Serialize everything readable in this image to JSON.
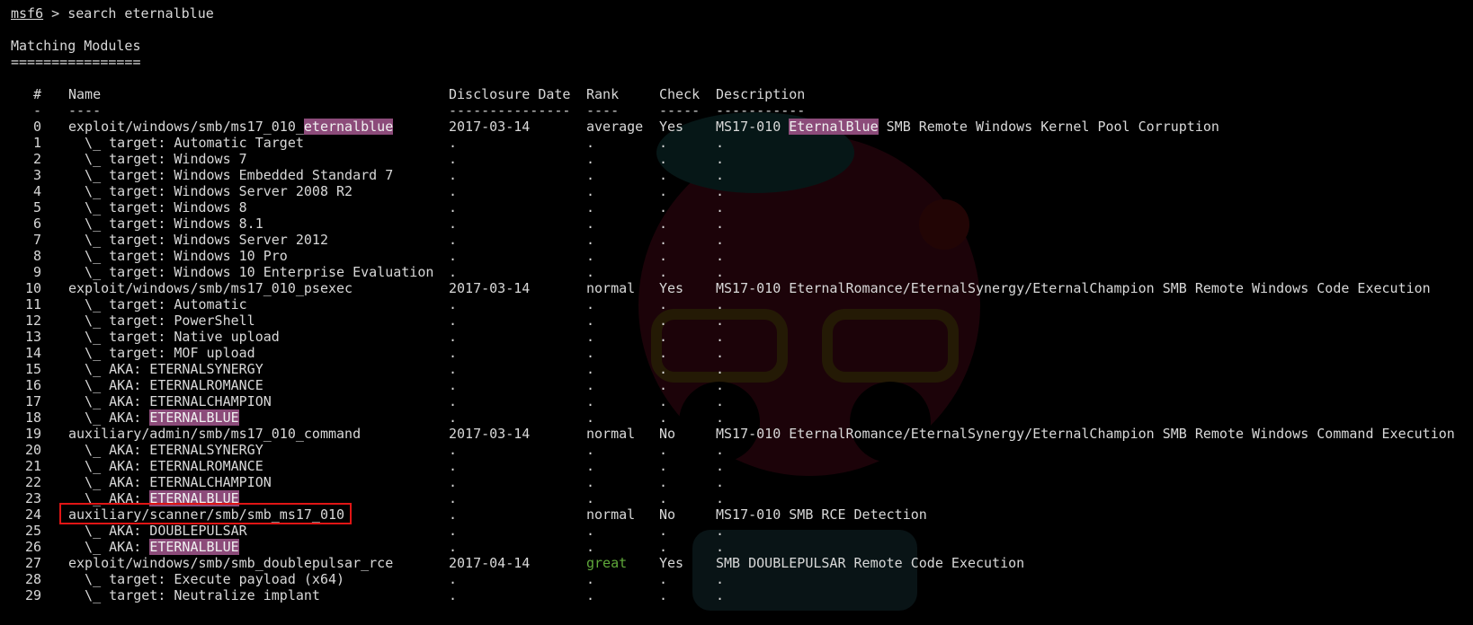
{
  "prompt": {
    "name": "msf6",
    "rest": " > search eternalblue"
  },
  "section_title": "Matching Modules",
  "section_underline": "================",
  "headers": {
    "num": "#",
    "name": "Name",
    "date": "Disclosure Date",
    "rank": "Rank",
    "check": "Check",
    "desc": "Description"
  },
  "header_rules": {
    "num": "-",
    "name": "----",
    "date": "---------------",
    "rank": "----",
    "check": "-----",
    "desc": "-----------"
  },
  "rows": [
    {
      "num": "0",
      "name_pre": "exploit/windows/smb/ms17_010_",
      "name_hl": "eternalblue",
      "date": "2017-03-14",
      "rank": "average",
      "check": "Yes",
      "desc_pre": "MS17-010 ",
      "desc_hl": "EternalBlue",
      "desc_post": " SMB Remote Windows Kernel Pool Corruption"
    },
    {
      "num": "1",
      "name_pre": "  \\_ target: Automatic Target",
      "date": ".",
      "rank": ".",
      "check": ".",
      "desc_pre": "."
    },
    {
      "num": "2",
      "name_pre": "  \\_ target: Windows 7",
      "date": ".",
      "rank": ".",
      "check": ".",
      "desc_pre": "."
    },
    {
      "num": "3",
      "name_pre": "  \\_ target: Windows Embedded Standard 7",
      "date": ".",
      "rank": ".",
      "check": ".",
      "desc_pre": "."
    },
    {
      "num": "4",
      "name_pre": "  \\_ target: Windows Server 2008 R2",
      "date": ".",
      "rank": ".",
      "check": ".",
      "desc_pre": "."
    },
    {
      "num": "5",
      "name_pre": "  \\_ target: Windows 8",
      "date": ".",
      "rank": ".",
      "check": ".",
      "desc_pre": "."
    },
    {
      "num": "6",
      "name_pre": "  \\_ target: Windows 8.1",
      "date": ".",
      "rank": ".",
      "check": ".",
      "desc_pre": "."
    },
    {
      "num": "7",
      "name_pre": "  \\_ target: Windows Server 2012",
      "date": ".",
      "rank": ".",
      "check": ".",
      "desc_pre": "."
    },
    {
      "num": "8",
      "name_pre": "  \\_ target: Windows 10 Pro",
      "date": ".",
      "rank": ".",
      "check": ".",
      "desc_pre": "."
    },
    {
      "num": "9",
      "name_pre": "  \\_ target: Windows 10 Enterprise Evaluation",
      "date": ".",
      "rank": ".",
      "check": ".",
      "desc_pre": "."
    },
    {
      "num": "10",
      "name_pre": "exploit/windows/smb/ms17_010_psexec",
      "date": "2017-03-14",
      "rank": "normal",
      "check": "Yes",
      "desc_pre": "MS17-010 EternalRomance/EternalSynergy/EternalChampion SMB Remote Windows Code Execution"
    },
    {
      "num": "11",
      "name_pre": "  \\_ target: Automatic",
      "date": ".",
      "rank": ".",
      "check": ".",
      "desc_pre": "."
    },
    {
      "num": "12",
      "name_pre": "  \\_ target: PowerShell",
      "date": ".",
      "rank": ".",
      "check": ".",
      "desc_pre": "."
    },
    {
      "num": "13",
      "name_pre": "  \\_ target: Native upload",
      "date": ".",
      "rank": ".",
      "check": ".",
      "desc_pre": "."
    },
    {
      "num": "14",
      "name_pre": "  \\_ target: MOF upload",
      "date": ".",
      "rank": ".",
      "check": ".",
      "desc_pre": "."
    },
    {
      "num": "15",
      "name_pre": "  \\_ AKA: ETERNALSYNERGY",
      "date": ".",
      "rank": ".",
      "check": ".",
      "desc_pre": "."
    },
    {
      "num": "16",
      "name_pre": "  \\_ AKA: ETERNALROMANCE",
      "date": ".",
      "rank": ".",
      "check": ".",
      "desc_pre": "."
    },
    {
      "num": "17",
      "name_pre": "  \\_ AKA: ETERNALCHAMPION",
      "date": ".",
      "rank": ".",
      "check": ".",
      "desc_pre": "."
    },
    {
      "num": "18",
      "name_pre": "  \\_ AKA: ",
      "name_hl": "ETERNALBLUE",
      "date": ".",
      "rank": ".",
      "check": ".",
      "desc_pre": "."
    },
    {
      "num": "19",
      "name_pre": "auxiliary/admin/smb/ms17_010_command",
      "date": "2017-03-14",
      "rank": "normal",
      "check": "No",
      "desc_pre": "MS17-010 EternalRomance/EternalSynergy/EternalChampion SMB Remote Windows Command Execution"
    },
    {
      "num": "20",
      "name_pre": "  \\_ AKA: ETERNALSYNERGY",
      "date": ".",
      "rank": ".",
      "check": ".",
      "desc_pre": "."
    },
    {
      "num": "21",
      "name_pre": "  \\_ AKA: ETERNALROMANCE",
      "date": ".",
      "rank": ".",
      "check": ".",
      "desc_pre": "."
    },
    {
      "num": "22",
      "name_pre": "  \\_ AKA: ETERNALCHAMPION",
      "date": ".",
      "rank": ".",
      "check": ".",
      "desc_pre": "."
    },
    {
      "num": "23",
      "name_pre": "  \\_ AKA: ",
      "name_hl": "ETERNALBLUE",
      "date": ".",
      "rank": ".",
      "check": ".",
      "desc_pre": "."
    },
    {
      "num": "24",
      "name_pre": "auxiliary/scanner/smb/smb_ms17_010",
      "date": ".",
      "rank": "normal",
      "check": "No",
      "desc_pre": "MS17-010 SMB RCE Detection",
      "boxed": true
    },
    {
      "num": "25",
      "name_pre": "  \\_ AKA: DOUBLEPULSAR",
      "date": ".",
      "rank": ".",
      "check": ".",
      "desc_pre": "."
    },
    {
      "num": "26",
      "name_pre": "  \\_ AKA: ",
      "name_hl": "ETERNALBLUE",
      "date": ".",
      "rank": ".",
      "check": ".",
      "desc_pre": "."
    },
    {
      "num": "27",
      "name_pre": "exploit/windows/smb/smb_doublepulsar_rce",
      "date": "2017-04-14",
      "rank": "great",
      "rank_color": "#5fa83a",
      "check": "Yes",
      "desc_pre": "SMB DOUBLEPULSAR Remote Code Execution"
    },
    {
      "num": "28",
      "name_pre": "  \\_ target: Execute payload (x64)",
      "date": ".",
      "rank": ".",
      "check": ".",
      "desc_pre": "."
    },
    {
      "num": "29",
      "name_pre": "  \\_ target: Neutralize implant",
      "date": ".",
      "rank": ".",
      "check": ".",
      "desc_pre": "."
    }
  ],
  "colors": {
    "background": "#000000",
    "text": "#d8d8d8",
    "highlight": "#8c4b7a",
    "great": "#5fa83a",
    "box": "#e01515"
  }
}
